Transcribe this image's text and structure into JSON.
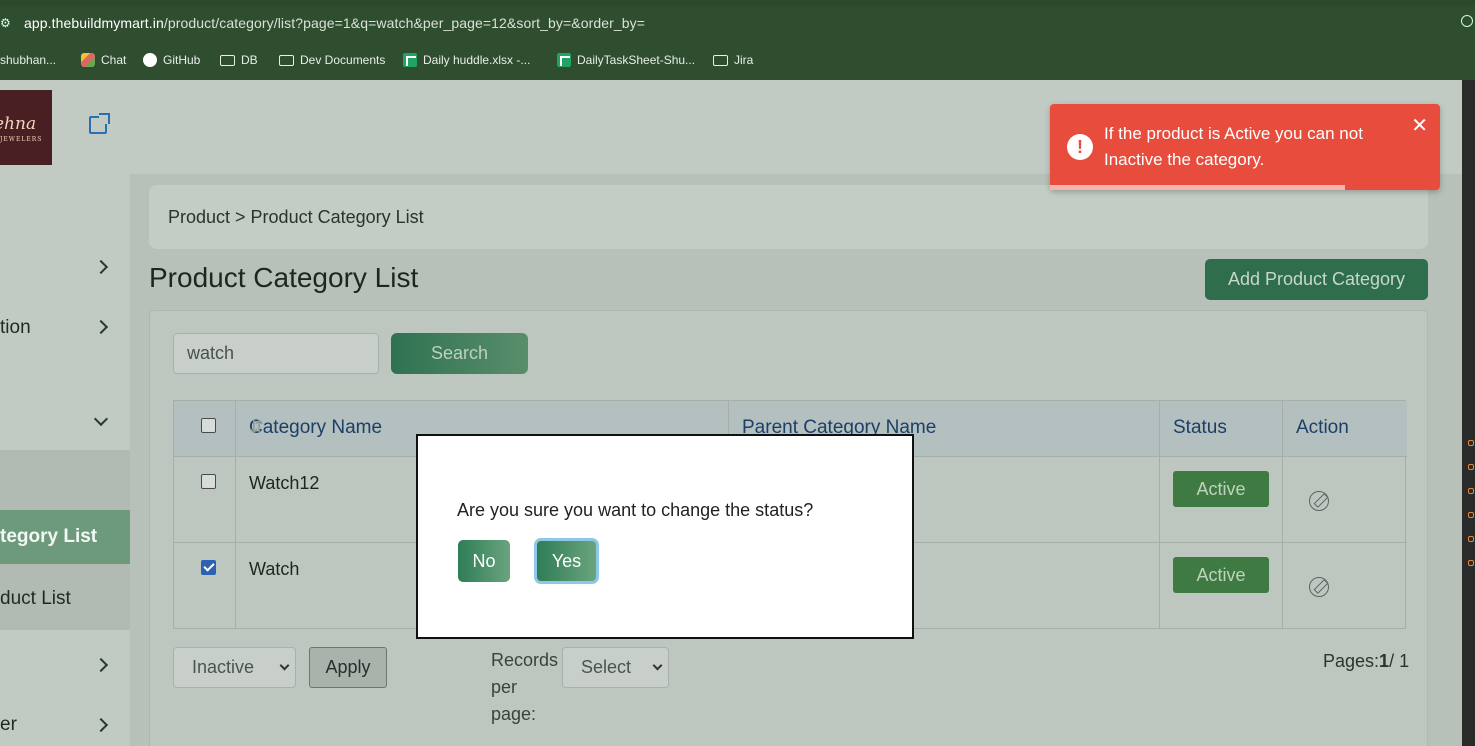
{
  "browser": {
    "url_host": "app.thebuildmymart.in",
    "url_path": "/product/category/list?page=1&q=watch&per_page=12&sort_by=&order_by=",
    "bookmarks": [
      {
        "label": "shubhan...",
        "icon": "profile-icon"
      },
      {
        "label": "Chat",
        "icon": "chat-icon"
      },
      {
        "label": "GitHub",
        "icon": "github-icon"
      },
      {
        "label": "DB",
        "icon": "folder-icon"
      },
      {
        "label": "Dev Documents",
        "icon": "folder-icon"
      },
      {
        "label": "Daily huddle.xlsx -...",
        "icon": "sheets-icon"
      },
      {
        "label": "DailyTaskSheet-Shu...",
        "icon": "sheets-icon"
      },
      {
        "label": "Jira",
        "icon": "folder-icon"
      }
    ]
  },
  "logo": {
    "text": "ehna",
    "subtext": "JEWELERS"
  },
  "sidebar": {
    "items": [
      {
        "label": ""
      },
      {
        "label": "tion"
      },
      {
        "label": ""
      },
      {
        "label": "tegory List"
      },
      {
        "label": "duct List"
      },
      {
        "label": ""
      },
      {
        "label": "er"
      }
    ]
  },
  "breadcrumb": "Product > Product Category List",
  "page_title": "Product Category List",
  "add_button": "Add Product Category",
  "search": {
    "value": "watch",
    "button": "Search"
  },
  "table": {
    "headers": [
      "Category Name",
      "Parent Category Name",
      "Status",
      "Action"
    ],
    "rows": [
      {
        "name": "Watch12",
        "parent": "",
        "status": "Active",
        "checked": false
      },
      {
        "name": "Watch",
        "parent": "",
        "status": "Active",
        "checked": true
      }
    ]
  },
  "bulk": {
    "selected": "Inactive",
    "apply": "Apply"
  },
  "records_per_page": {
    "label": "Records per page:",
    "selected": "Select"
  },
  "pages": {
    "label": "Pages:",
    "current": "1",
    "total": "/ 1"
  },
  "modal": {
    "message": "Are you sure you want to change the status?",
    "no": "No",
    "yes": "Yes"
  },
  "toast": {
    "message": "If the product is Active you can not Inactive the category.",
    "color": "#e74c3c",
    "icon": "exclamation-icon",
    "close": "✕"
  }
}
